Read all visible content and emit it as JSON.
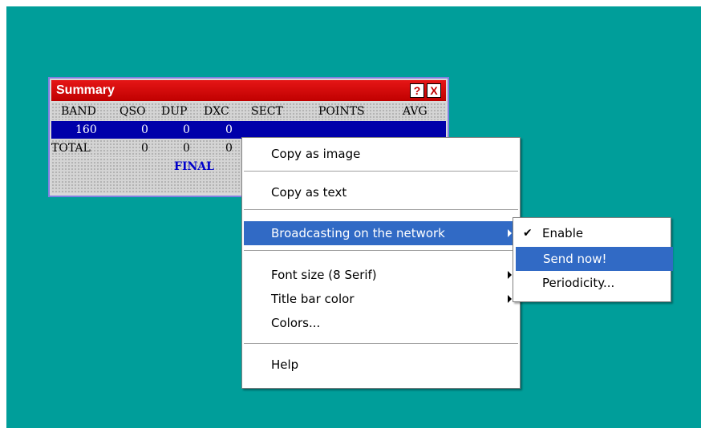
{
  "summary": {
    "title": "Summary",
    "help_btn": "?",
    "close_btn": "X",
    "headers": [
      "BAND",
      "QSO",
      "DUP",
      "DXC",
      "SECT",
      "POINTS",
      "AVG"
    ],
    "rows": [
      [
        "160",
        "0",
        "0",
        "0"
      ],
      [
        "TOTAL",
        "0",
        "0",
        "0"
      ]
    ],
    "final_label": "FINAL"
  },
  "context_menu": {
    "items": {
      "copy_image": "Copy as image",
      "copy_text": "Copy as text",
      "broadcasting": "Broadcasting on the network",
      "font_size": "Font size (8 Serif)",
      "title_bar_color": "Title bar color",
      "colors": "Colors...",
      "help": "Help"
    }
  },
  "submenu": {
    "enable": "Enable",
    "enable_checked": true,
    "send_now": "Send now!",
    "periodicity": "Periodicity..."
  },
  "colors": {
    "desktop": "#009e9a",
    "title_bar": "#c00000",
    "selection": "#316ac5",
    "row_highlight": "#0000aa"
  }
}
